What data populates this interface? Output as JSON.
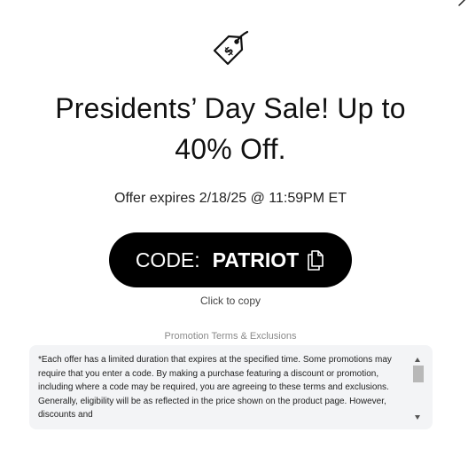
{
  "promo": {
    "headline": "Presidents’ Day Sale! Up to 40% Off.",
    "expires": "Offer expires 2/18/25 @ 11:59PM ET",
    "code_prefix": "CODE:",
    "code_value": "PATRIOT",
    "click_to_copy": "Click to copy"
  },
  "terms": {
    "title": "Promotion Terms & Exclusions",
    "text": "*Each offer has a limited duration that expires at the specified time. Some promotions may require that you enter a code. By making a purchase featuring a discount or promotion, including where a code may be required, you are agreeing to these terms and exclusions. Generally, eligibility will be as reflected in the price shown on the product page. However, discounts and",
    "scroll_position": 0
  },
  "icons": {
    "tag": "price-tag-dollar-icon",
    "copy": "copy-icon",
    "close": "close-icon"
  },
  "colors": {
    "button_bg": "#000000",
    "button_text": "#ffffff",
    "terms_bg": "#f3f4f6"
  }
}
